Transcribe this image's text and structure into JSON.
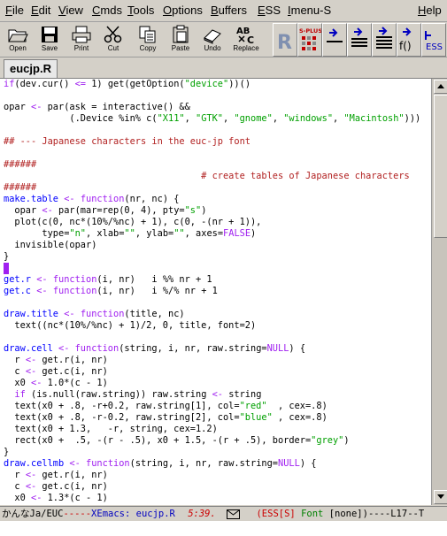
{
  "menubar": {
    "items": [
      {
        "label": "File",
        "u": "F",
        "rest": "ile"
      },
      {
        "label": "Edit",
        "u": "E",
        "rest": "dit"
      },
      {
        "label": "View",
        "u": "V",
        "rest": "iew"
      },
      {
        "label": "Cmds",
        "u": "C",
        "rest": "mds"
      },
      {
        "label": "Tools",
        "u": "T",
        "rest": "ools"
      },
      {
        "label": "Options",
        "u": "O",
        "rest": "ptions"
      },
      {
        "label": "Buffers",
        "u": "B",
        "rest": "uffers"
      },
      {
        "label": "ESS",
        "u": "E",
        "rest": "SS"
      },
      {
        "label": "Imenu-S",
        "u": "I",
        "rest": "menu-S"
      },
      {
        "label": "Help",
        "u": "H",
        "rest": "elp"
      }
    ]
  },
  "toolbar": {
    "open": "Open",
    "save": "Save",
    "print": "Print",
    "cut": "Cut",
    "copy": "Copy",
    "paste": "Paste",
    "undo": "Undo",
    "replace": "Replace",
    "r_logo": "R",
    "splus_logo": "S-PLUS",
    "func_label": "f()",
    "ess_label": "ESS"
  },
  "tab": {
    "label": "eucjp.R"
  },
  "colors": {
    "keyword": "#a020f0",
    "function": "#0000ff",
    "string": "#00a000",
    "comment": "#b22222",
    "mode_red": "#cc0000"
  },
  "code_lines": [
    "if(dev.cur() <= 1) get(getOption(\"device\"))()",
    "",
    "opar <- par(ask = interactive() &&",
    "            (.Device %in% c(\"X11\", \"GTK\", \"gnome\", \"windows\", \"Macintosh\")))",
    "",
    "## --- Japanese characters in the euc-jp font",
    "",
    "######",
    "                                    # create tables of Japanese characters",
    "######",
    "make.table <- function(nr, nc) {",
    "  opar <- par(mar=rep(0, 4), pty=\"s\")",
    "  plot(c(0, nc*(10%/%nc) + 1), c(0, -(nr + 1)),",
    "       type=\"n\", xlab=\"\", ylab=\"\", axes=FALSE)",
    "  invisible(opar)",
    "}",
    "",
    "get.r <- function(i, nr)   i %% nr + 1",
    "get.c <- function(i, nr)   i %/% nr + 1",
    "",
    "draw.title <- function(title, nc)",
    "  text((nc*(10%/%nc) + 1)/2, 0, title, font=2)",
    "",
    "draw.cell <- function(string, i, nr, raw.string=NULL) {",
    "  r <- get.r(i, nr)",
    "  c <- get.c(i, nr)",
    "  x0 <- 1.0*(c - 1)",
    "  if (is.null(raw.string)) raw.string <- string",
    "  text(x0 + .8, -r+0.2, raw.string[1], col=\"red\"  , cex=.8)",
    "  text(x0 + .8, -r-0.2, raw.string[2], col=\"blue\" , cex=.8)",
    "  text(x0 + 1.3,   -r, string, cex=1.2)",
    "  rect(x0 +  .5, -(r - .5), x0 + 1.5, -(r + .5), border=\"grey\")",
    "}",
    "draw.cellmb <- function(string, i, nr, raw.string=NULL) {",
    "  r <- get.r(i, nr)",
    "  c <- get.c(i, nr)",
    "  x0 <- 1.3*(c - 1)"
  ],
  "modeline": {
    "encoding": "かんなJa/EUC",
    "dashes1": "-----",
    "app": "XEmacs: eucjp.R",
    "position": "5:39.",
    "mode_open": "(",
    "mode_ess": "ESS[S]",
    "mode_font": "Font",
    "mode_rest": "[none])",
    "dashes2": "----L17--T"
  }
}
